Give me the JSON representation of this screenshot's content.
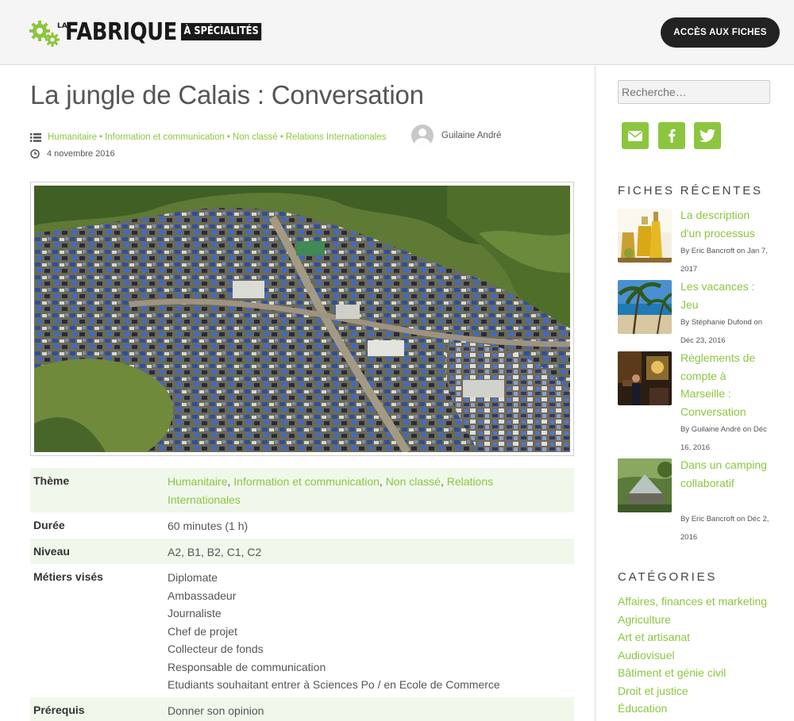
{
  "header": {
    "logo_la": "LA",
    "logo_main": "FABRIQUE",
    "logo_spec": "À SPÉCIALITÉS",
    "cta_label": "ACCÈS AUX FICHES"
  },
  "post": {
    "title": "La jungle de Calais : Conversation",
    "categories": [
      "Humanitaire",
      "Information et communication",
      "Non classé",
      "Relations Internationales"
    ],
    "category_separator": "•",
    "author": "Guilaine André",
    "date": "4 novembre 2016"
  },
  "info_table": {
    "theme_label": "Thème",
    "theme_values": [
      "Humanitaire",
      "Information et communication",
      "Non classé",
      "Relations Internationales"
    ],
    "duree_label": "Durée",
    "duree_value": "60 minutes (1 h)",
    "niveau_label": "Niveau",
    "niveau_value": "A2, B1, B2, C1, C2",
    "metiers_label": "Métiers visés",
    "metiers": [
      "Diplomate",
      "Ambassadeur",
      "Journaliste",
      "Chef de projet",
      "Collecteur de fonds",
      "Responsable de communication",
      "Etudiants souhaitant entrer à Sciences Po / en Ecole de Commerce"
    ],
    "prerequis_label": "Prérequis",
    "prerequis_value": "Donner son opinion"
  },
  "sidebar": {
    "search_placeholder": "Recherche…",
    "share_icons": [
      "mail-icon",
      "facebook-icon",
      "twitter-icon"
    ],
    "recent_heading": "FICHES RÉCENTES",
    "recent": [
      {
        "title": "La description d'un processus",
        "meta": "By Eric Bancroft on Jan 7, 2017"
      },
      {
        "title": "Les vacances : Jeu",
        "meta": "By Stéphanie Dufond on Déc 23, 2016"
      },
      {
        "title": "Règlements de compte à Marseille : Conversation",
        "meta": "By Guilaine André on Déc 16, 2016"
      },
      {
        "title": "Dans un camping collaboratif",
        "meta": "By Eric Bancroft on Déc 2, 2016"
      }
    ],
    "categories_heading": "CATÉGORIES",
    "categories": [
      "Affaires, finances et marketing",
      "Agriculture",
      "Art et artisanat",
      "Audiovisuel",
      "Bâtiment et génie civil",
      "Droit et justice",
      "Éducation"
    ]
  },
  "colors": {
    "accent": "#8cc63f",
    "button_dark": "#222222",
    "header_bg": "#f5f5f5",
    "table_alt_bg": "#f0f8ec"
  }
}
